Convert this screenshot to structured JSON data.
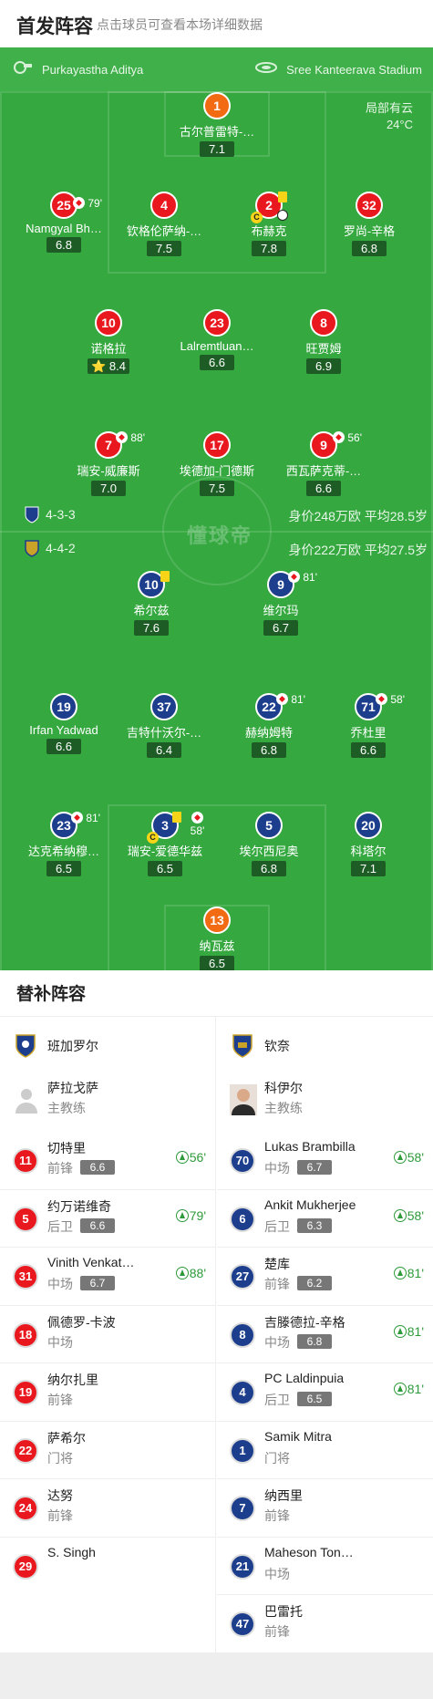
{
  "header": {
    "title": "首发阵容",
    "hint": "点击球员可查看本场详细数据"
  },
  "match": {
    "referee": "Purkayastha Aditya",
    "venue": "Sree Kanteerava Stadium",
    "weather_desc": "局部有云",
    "weather_temp": "24°C"
  },
  "home_bar": {
    "formation": "4-3-3",
    "stats": "身价248万欧   平均28.5岁"
  },
  "away_bar": {
    "formation": "4-4-2",
    "stats": "身价222万欧   平均27.5岁"
  },
  "watermark": "懂球帝",
  "home_players": [
    {
      "num": "1",
      "name": "古尔普雷特-…",
      "rating": "7.1",
      "kit": "orange"
    },
    {
      "num": "25",
      "name": "Namgyal Bh…",
      "rating": "6.8",
      "kit": "red",
      "sub_min": "79'"
    },
    {
      "num": "4",
      "name": "钦格伦萨纳-…",
      "rating": "7.5",
      "kit": "red"
    },
    {
      "num": "2",
      "name": "布赫克",
      "rating": "7.8",
      "kit": "red"
    },
    {
      "num": "32",
      "name": "罗尚-辛格",
      "rating": "6.8",
      "kit": "red"
    },
    {
      "num": "10",
      "name": "诺格拉",
      "rating": "8.4",
      "kit": "red",
      "star": "⭐"
    },
    {
      "num": "23",
      "name": "Lalremtluan…",
      "rating": "6.6",
      "kit": "red"
    },
    {
      "num": "8",
      "name": "旺贾姆",
      "rating": "6.9",
      "kit": "red"
    },
    {
      "num": "7",
      "name": "瑞安-威廉斯",
      "rating": "7.0",
      "kit": "red",
      "sub_min": "88'"
    },
    {
      "num": "17",
      "name": "埃德加-门德斯",
      "rating": "7.5",
      "kit": "red"
    },
    {
      "num": "9",
      "name": "西瓦萨克蒂-…",
      "rating": "6.6",
      "kit": "red",
      "sub_min": "56'"
    }
  ],
  "away_players": [
    {
      "num": "10",
      "name": "希尔兹",
      "rating": "7.6",
      "kit": "blue"
    },
    {
      "num": "9",
      "name": "维尔玛",
      "rating": "6.7",
      "kit": "blue",
      "sub_min": "81'"
    },
    {
      "num": "19",
      "name": "Irfan Yadwad",
      "rating": "6.6",
      "kit": "blue"
    },
    {
      "num": "37",
      "name": "吉特什沃尔-…",
      "rating": "6.4",
      "kit": "blue"
    },
    {
      "num": "22",
      "name": "赫纳姆特",
      "rating": "6.8",
      "kit": "blue",
      "sub_min": "81'"
    },
    {
      "num": "71",
      "name": "乔杜里",
      "rating": "6.6",
      "kit": "blue",
      "sub_min": "58'"
    },
    {
      "num": "23",
      "name": "达克希纳穆…",
      "rating": "6.5",
      "kit": "blue",
      "sub_min": "81'"
    },
    {
      "num": "3",
      "name": "瑞安-爱德华兹",
      "rating": "6.5",
      "kit": "blue",
      "sub_min": "58'"
    },
    {
      "num": "5",
      "name": "埃尔西尼奥",
      "rating": "6.8",
      "kit": "blue"
    },
    {
      "num": "20",
      "name": "科塔尔",
      "rating": "7.1",
      "kit": "blue"
    },
    {
      "num": "13",
      "name": "纳瓦兹",
      "rating": "6.5",
      "kit": "orange"
    }
  ],
  "subs": {
    "title": "替补阵容",
    "home": {
      "team": "班加罗尔",
      "coach": "萨拉戈萨",
      "coach_role": "主教练",
      "players": [
        {
          "num": "11",
          "name": "切特里",
          "pos": "前锋",
          "rating": "6.6",
          "min": "56'"
        },
        {
          "num": "5",
          "name": "约万诺维奇",
          "pos": "后卫",
          "rating": "6.6",
          "min": "79'"
        },
        {
          "num": "31",
          "name": "Vinith Venkat…",
          "pos": "中场",
          "rating": "6.7",
          "min": "88'"
        },
        {
          "num": "18",
          "name": "佩德罗-卡波",
          "pos": "中场"
        },
        {
          "num": "19",
          "name": "纳尔扎里",
          "pos": "前锋"
        },
        {
          "num": "22",
          "name": "萨希尔",
          "pos": "门将"
        },
        {
          "num": "24",
          "name": "达努",
          "pos": "前锋"
        },
        {
          "num": "29",
          "name": "S. Singh",
          "pos": ""
        }
      ]
    },
    "away": {
      "team": "钦奈",
      "coach": "科伊尔",
      "coach_role": "主教练",
      "players": [
        {
          "num": "70",
          "name": "Lukas Brambilla",
          "pos": "中场",
          "rating": "6.7",
          "min": "58'"
        },
        {
          "num": "6",
          "name": "Ankit Mukherjee",
          "pos": "后卫",
          "rating": "6.3",
          "min": "58'"
        },
        {
          "num": "27",
          "name": "楚库",
          "pos": "前锋",
          "rating": "6.2",
          "min": "81'"
        },
        {
          "num": "8",
          "name": "吉滕德拉-辛格",
          "pos": "中场",
          "rating": "6.8",
          "min": "81'"
        },
        {
          "num": "4",
          "name": "PC Laldinpuia",
          "pos": "后卫",
          "rating": "6.5",
          "min": "81'"
        },
        {
          "num": "1",
          "name": "Samik Mitra",
          "pos": "门将"
        },
        {
          "num": "7",
          "name": "纳西里",
          "pos": "前锋"
        },
        {
          "num": "21",
          "name": "Maheson Ton…",
          "pos": "中场"
        },
        {
          "num": "47",
          "name": "巴雷托",
          "pos": "前锋"
        }
      ]
    }
  }
}
